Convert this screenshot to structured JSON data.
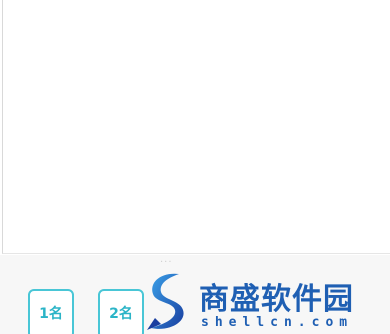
{
  "bottom": {
    "faint_label": "···",
    "rank_buttons": [
      {
        "label": "1名"
      },
      {
        "label": "2名"
      }
    ]
  },
  "watermark": {
    "title": "商盛软件园",
    "subtitle": "shellcn.com"
  },
  "colors": {
    "accent": "#49c6d6",
    "accent_text": "#2bb4c7",
    "watermark_blue": "#1f5fb3"
  }
}
